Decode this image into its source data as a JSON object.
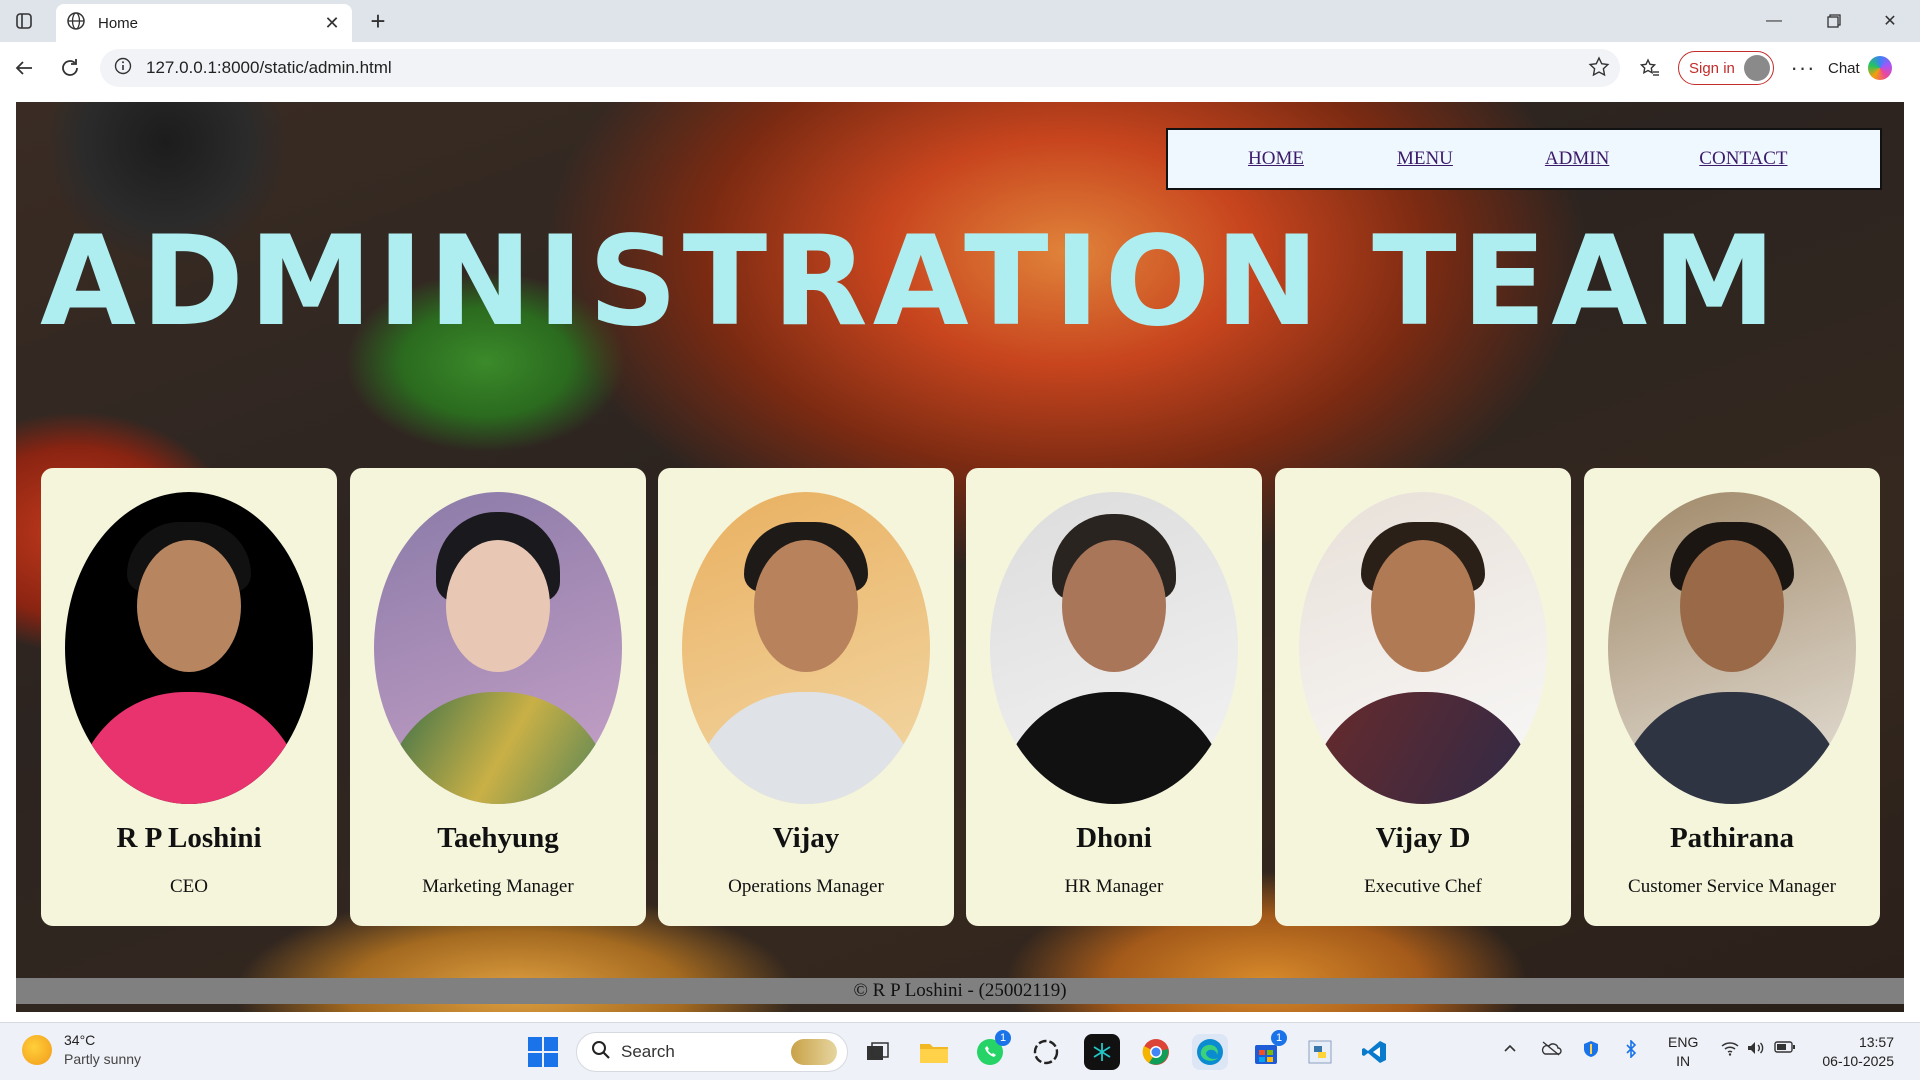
{
  "browser": {
    "tab_title": "Home",
    "url": "127.0.0.1:8000/static/admin.html",
    "sign_in": "Sign in",
    "chat": "Chat"
  },
  "site": {
    "nav": [
      "HOME",
      "MENU",
      "ADMIN",
      "CONTACT"
    ],
    "heading": "ADMINISTRATION TEAM",
    "team": [
      {
        "name": "R P Loshini",
        "role": "CEO"
      },
      {
        "name": "Taehyung",
        "role": "Marketing Manager"
      },
      {
        "name": "Vijay",
        "role": "Operations Manager"
      },
      {
        "name": "Dhoni",
        "role": "HR Manager"
      },
      {
        "name": "Vijay D",
        "role": "Executive Chef"
      },
      {
        "name": "Pathirana",
        "role": "Customer Service Manager"
      }
    ],
    "footer": "© R P Loshini - (25002119)"
  },
  "taskbar": {
    "weather_temp": "34°C",
    "weather_desc": "Partly sunny",
    "search_label": "Search",
    "whatsapp_badge": "1",
    "store_badge": "1",
    "lang_line1": "ENG",
    "lang_line2": "IN",
    "time": "13:57",
    "date": "06-10-2025"
  }
}
